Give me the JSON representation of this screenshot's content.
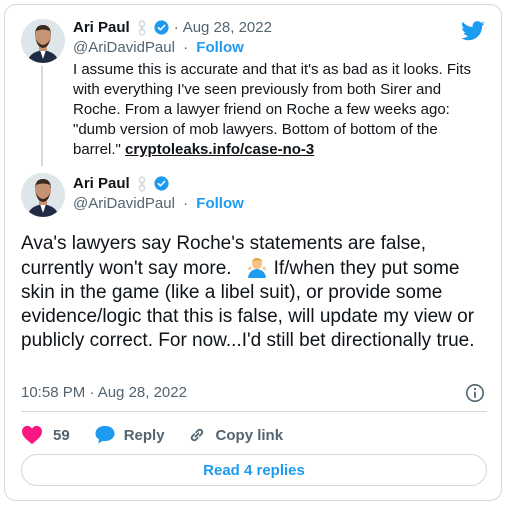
{
  "colors": {
    "brand_blue": "#1d9bf0",
    "text_primary": "#0f1419",
    "text_secondary": "#536471",
    "border": "#cfd9de",
    "like_pink": "#f91880"
  },
  "quoted_tweet": {
    "author_name": "Ari Paul",
    "date": "Aug 28, 2022",
    "handle": "@AriDavidPaul",
    "follow_label": "Follow",
    "text_part1": "I assume this is accurate and that it's as bad as it looks.  Fits with everything I've seen previously from both Sirer and Roche. From a lawyer friend on Roche a few weeks ago: \"dumb version of mob lawyers.  Bottom of bottom of the barrel.\"  ",
    "link_text": "cryptoleaks.info/case-no-3",
    "icons": [
      "chain-icon",
      "verified-badge-icon",
      "twitter-bird-icon"
    ]
  },
  "main_tweet": {
    "author_name": "Ari Paul",
    "handle": "@AriDavidPaul",
    "follow_label": "Follow",
    "text_part1": "Ava's lawyers say Roche's statements are false, currently won't say more.",
    "emoji_name": "man-shrugging-emoji",
    "text_part2": "If/when they put some skin in the game (like a libel suit), or provide some evidence/logic that this is false, will update my view or publicly correct.  For now...I'd still bet directionally true.",
    "timestamp": "10:58 PM · Aug 28, 2022"
  },
  "actions": {
    "like_count": "59",
    "reply_label": "Reply",
    "copy_link_label": "Copy link"
  },
  "read_replies_label": "Read 4 replies"
}
